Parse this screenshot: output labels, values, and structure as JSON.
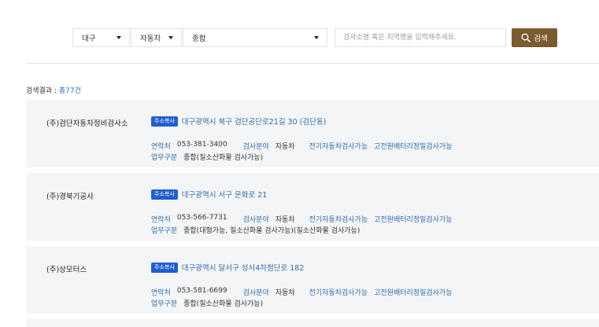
{
  "search": {
    "region": "대구",
    "vehicle_type": "자동차",
    "inspection_class": "종합",
    "placeholder": "검사소명 혹은 지역명을 입력해주세요.",
    "button_label": "검색"
  },
  "results": {
    "label": "검색결과 : ",
    "count": "총77건"
  },
  "labels": {
    "contact": "연락처",
    "field": "검사분야",
    "work_type": "업무구분",
    "copy_address": "주소복사"
  },
  "items": [
    {
      "name": "(주)검단자동차정비검사소",
      "address": "대구광역시 북구 검단공단로21길 30 (검단동)",
      "phone": "053-381-3400",
      "field": "자동차",
      "tags": [
        "전기자동차검사가능",
        "고전원배터리정밀검사가능"
      ],
      "work_type": "종합(질소산화물 검사가능)"
    },
    {
      "name": "(주)경북기공사",
      "address": "대구광역시 서구 문화로 21",
      "phone": "053-566-7731",
      "field": "자동차",
      "tags": [
        "전기자동차검사가능",
        "고전원배터리정밀검사가능"
      ],
      "work_type": "종합(대형가능, 질소산화물 검사가능)(질소산화물 검사가능)"
    },
    {
      "name": "(주)상모터스",
      "address": "대구광역시 달서구 성서4차첨단로 182",
      "phone": "053-581-6699",
      "field": "자동차",
      "tags": [
        "전기자동차검사가능",
        "고전원배터리정밀검사가능"
      ],
      "work_type": "종합(질소산화물 검사가능)"
    }
  ],
  "colors": {
    "accent": "#7a5a2e",
    "link": "#2d6ca8",
    "badge": "#1f5fcf",
    "card_bg": "#f4f5f7"
  }
}
